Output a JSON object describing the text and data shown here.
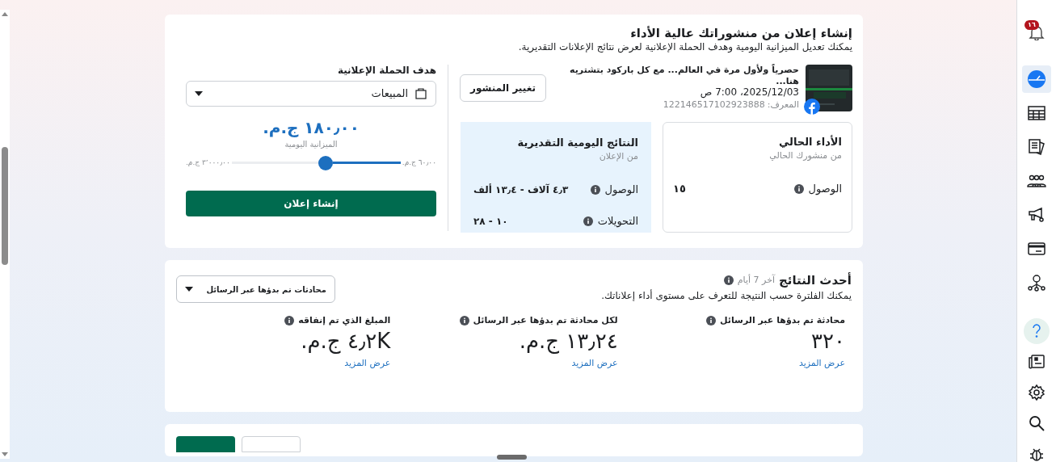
{
  "sidebar": {
    "notification_badge": "١٦",
    "items": [
      {
        "selected": true
      },
      {
        "selected": false
      },
      {
        "selected": false
      },
      {
        "selected": false
      },
      {
        "selected": false
      },
      {
        "selected": false
      },
      {
        "selected": false
      }
    ],
    "tools": [
      {
        "selected": true
      },
      {
        "selected": false
      },
      {
        "selected": false
      },
      {
        "selected": false
      },
      {
        "selected": false
      }
    ]
  },
  "boost_card": {
    "title": "إنشاء إعلان من منشوراتك عالية الأداء",
    "subtitle": "يمكنك تعديل الميزانية اليومية وهدف الحملة الإعلانية لعرض نتائج الإعلانات التقديرية.",
    "post": {
      "text": "حصرياً ولأول مرة في العالم... مع كل باركود بتشتريه هنا...",
      "date": "2025/12/03، 7:00 ص",
      "id_label": "المعرف:",
      "id": "122146517102923888"
    },
    "change_post_button": "تغيير المنشور",
    "current_performance": {
      "title": "الأداء الحالي",
      "subtitle": "من منشورك الحالي",
      "metrics": [
        {
          "label": "الوصول",
          "value": "١٥"
        }
      ]
    },
    "estimated_results": {
      "title": "النتائج اليومية التقديرية",
      "subtitle": "من الإعلان",
      "metrics": [
        {
          "label": "الوصول",
          "value": "٤٫٣ آلاف - ١٣٫٤ ألف"
        },
        {
          "label": "التحويلات",
          "value": "١٠ - ٢٨"
        }
      ]
    },
    "goal": {
      "label": "هدف الحملة الإعلانية",
      "value": "المبيعات"
    },
    "budget": {
      "amount": "١٨٠٫٠٠ ج.م.",
      "label": "الميزانية اليومية",
      "min": "٦٠٫٠٠ ج.م.",
      "max": "٣٬٠٠٠٫٠٠ ج.م.",
      "level": 0.4
    },
    "create_button": "إنشاء إعلان"
  },
  "results_card": {
    "title": "أحدث النتائج",
    "period": "آخر 7 أيام",
    "description": "يمكنك الفلترة حسب النتيجة للتعرف على مستوى أداء إعلاناتك.",
    "filter": "محادثات تم بدؤها عبر الرسائل",
    "metrics": [
      {
        "label": "محادثة تم بدؤها عبر الرسائل",
        "value": "٣٢٠",
        "link": "عرض المزيد"
      },
      {
        "label": "لكل محادثة تم بدؤها عبر الرسائل",
        "value": "١٣٫٢٤ ج.م.",
        "link": "عرض المزيد"
      },
      {
        "label": "المبلغ الذي تم إنفاقه",
        "value": "٤٫٢K ج.م.",
        "link": "عرض المزيد"
      }
    ]
  }
}
